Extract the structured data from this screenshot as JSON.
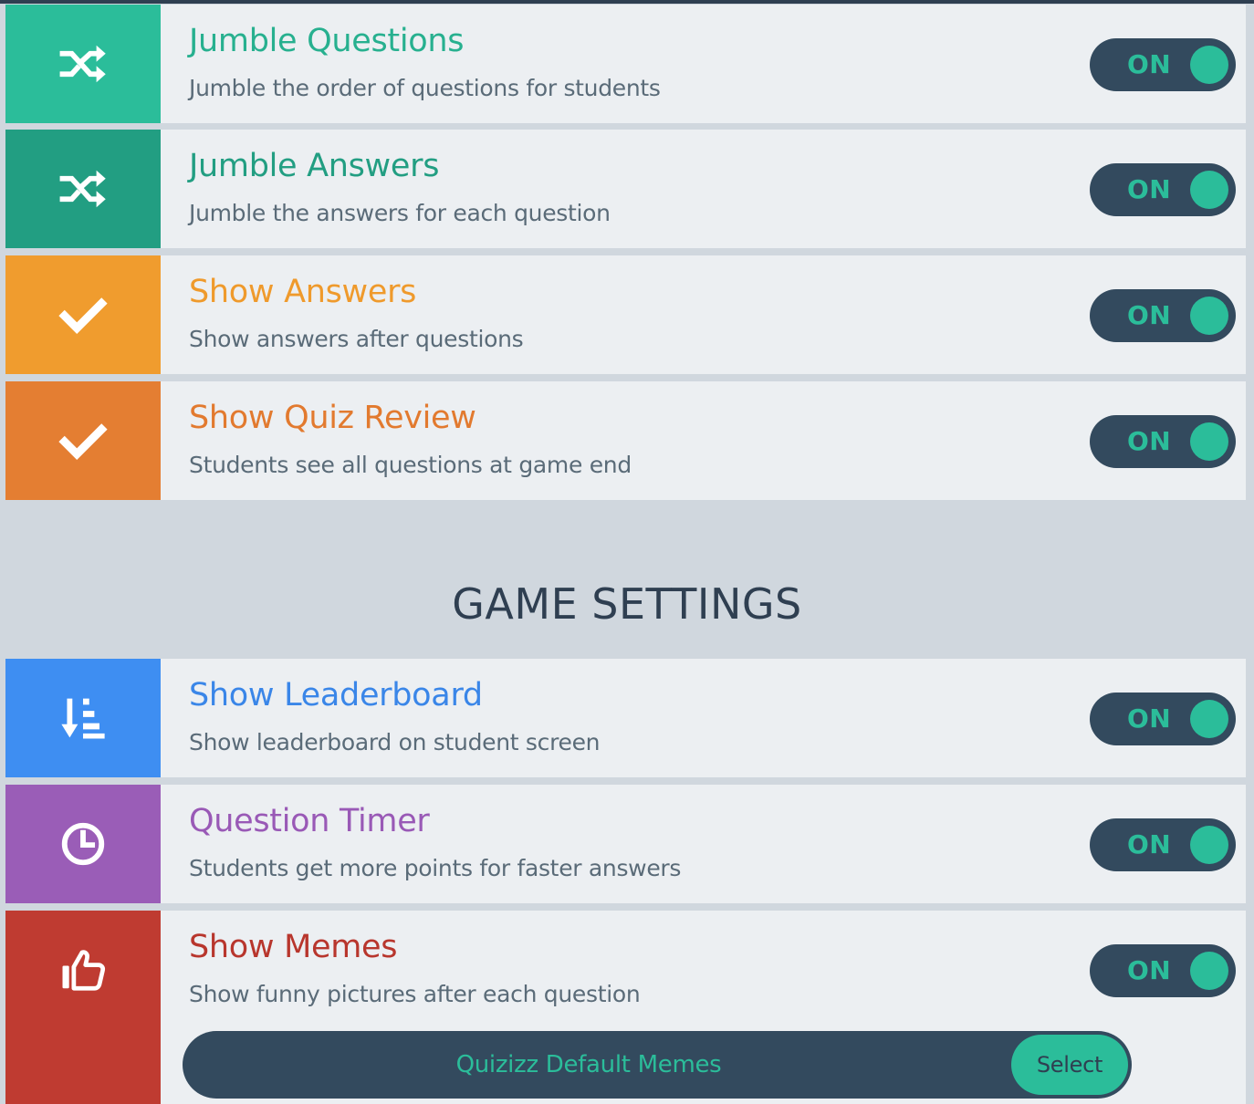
{
  "colors": {
    "toggle_bg": "#334a5e",
    "toggle_accent": "#2bbd9a",
    "row_bg": "#eceff2",
    "page_bg": "#d0d7de",
    "heading_text": "#2f3f51"
  },
  "quiz_settings": [
    {
      "title": "Jumble Questions",
      "description": "Jumble the order of questions for students",
      "icon": "shuffle-icon",
      "color": "#2bbd9a",
      "title_color": "#27b08f",
      "toggle": "ON"
    },
    {
      "title": "Jumble Answers",
      "description": "Jumble the answers for each question",
      "icon": "shuffle-icon",
      "color": "#229e82",
      "title_color": "#229e82",
      "toggle": "ON"
    },
    {
      "title": "Show Answers",
      "description": "Show answers after questions",
      "icon": "checkmark-icon",
      "color": "#f09c2e",
      "title_color": "#ef9a2c",
      "toggle": "ON"
    },
    {
      "title": "Show Quiz Review",
      "description": "Students see all questions at game end",
      "icon": "checkmark-icon",
      "color": "#e47e32",
      "title_color": "#e27a2f",
      "toggle": "ON"
    }
  ],
  "game_settings_header": "GAME SETTINGS",
  "game_settings": [
    {
      "title": "Show Leaderboard",
      "description": "Show leaderboard on student screen",
      "icon": "leaderboard-sort-icon",
      "color": "#3e8ef2",
      "title_color": "#3a86e8",
      "toggle": "ON"
    },
    {
      "title": "Question Timer",
      "description": "Students get more points for faster answers",
      "icon": "clock-icon",
      "color": "#9a5db7",
      "title_color": "#9959b6",
      "toggle": "ON"
    },
    {
      "title": "Show Memes",
      "description": "Show funny pictures after each question",
      "icon": "thumbs-up-icon",
      "color": "#bf3b31",
      "title_color": "#b8362d",
      "toggle": "ON",
      "meme_set": {
        "label": "Quizizz Default Memes",
        "button": "Select"
      }
    }
  ]
}
